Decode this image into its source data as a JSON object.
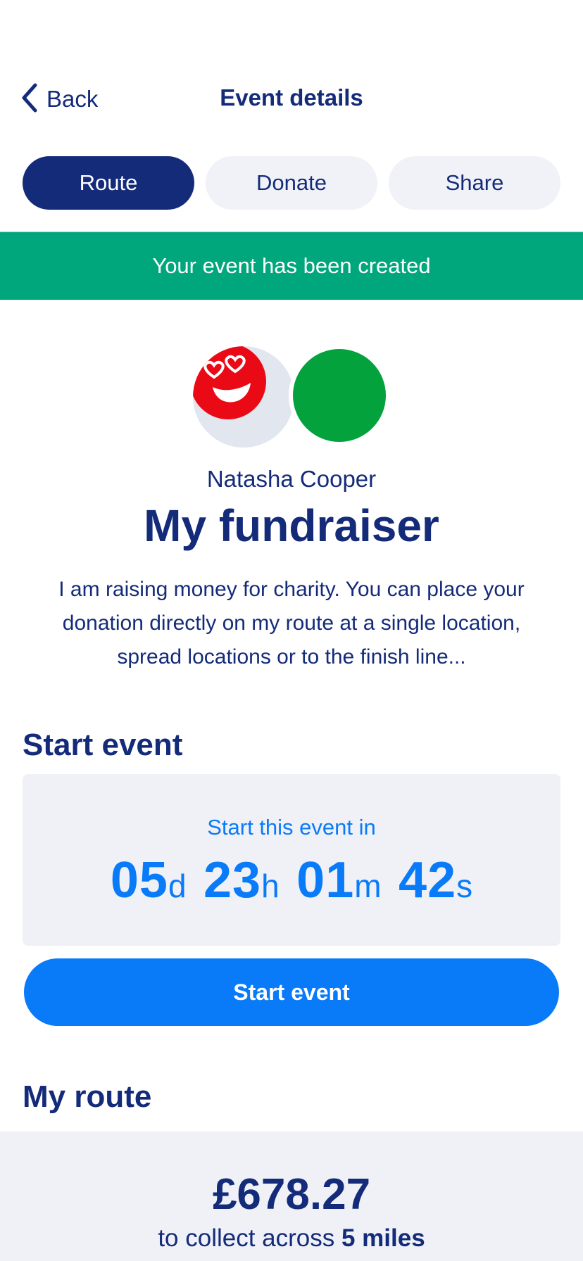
{
  "header": {
    "back_label": "Back",
    "title": "Event details"
  },
  "tabs": [
    {
      "label": "Route",
      "active": true
    },
    {
      "label": "Donate",
      "active": false
    },
    {
      "label": "Share",
      "active": false
    }
  ],
  "banner": {
    "text": "Your event has been created",
    "color": "#00a77c"
  },
  "profile": {
    "avatar_icons": [
      "heart-eyes-emoji-icon",
      "green-circle-avatar"
    ],
    "owner_name": "Natasha Cooper",
    "fundraiser_title": "My fundraiser",
    "description": "I am raising money for charity. You can place your donation directly on my route at a single location, spread locations or to the finish line..."
  },
  "start_event": {
    "section_title": "Start event",
    "countdown_label": "Start this event in",
    "countdown": {
      "days": "05",
      "days_unit": "d",
      "hours": "23",
      "hours_unit": "h",
      "minutes": "01",
      "minutes_unit": "m",
      "seconds": "42",
      "seconds_unit": "s"
    },
    "button_label": "Start event"
  },
  "route": {
    "section_title": "My route",
    "amount": "£678.27",
    "collect_prefix": "to collect across",
    "distance": "5 miles"
  },
  "colors": {
    "primary": "#142b7a",
    "accent": "#0a7bf8",
    "success": "#00a77c",
    "surface": "#eff1f6",
    "emoji_red": "#ea0a16",
    "avatar_green": "#03a23c"
  }
}
